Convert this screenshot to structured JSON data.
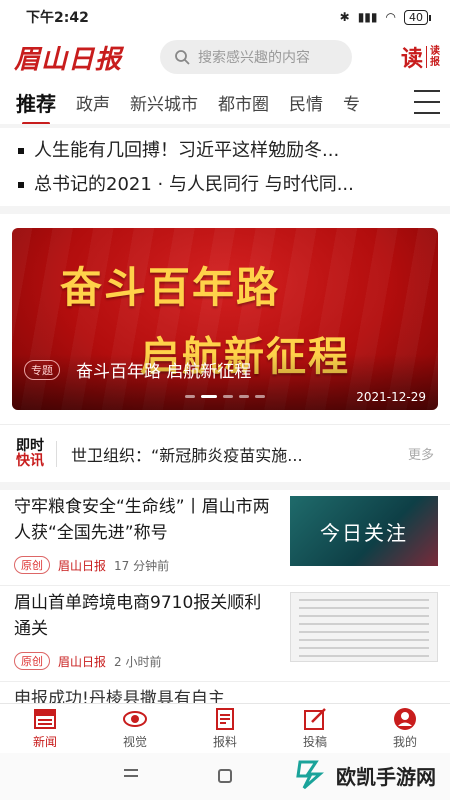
{
  "status": {
    "time": "下午2:42",
    "battery": "40"
  },
  "header": {
    "logo": "眉山日报",
    "search_placeholder": "搜索感兴趣的内容",
    "read_logo_big": "读",
    "read_logo_small": "读报"
  },
  "tabs": [
    "推荐",
    "政声",
    "新兴城市",
    "都市圈",
    "民情",
    "专"
  ],
  "headlines": [
    "人生能有几回搏！习近平这样勉励冬...",
    "总书记的2021 · 与人民同行 与时代同..."
  ],
  "banner": {
    "line1": "奋斗百年路",
    "line2": "启航新征程",
    "tag": "专题",
    "caption": "奋斗百年路 启航新征程",
    "date": "2021-12-29"
  },
  "flash": {
    "badge_top": "即时",
    "badge_bottom": "快讯",
    "text": "世卫组织：“新冠肺炎疫苗实施...",
    "more": "更多"
  },
  "feed": [
    {
      "title": "守牢粮食安全“生命线”丨眉山市两人获“全国先进”称号",
      "orig": "原创",
      "source": "眉山日报",
      "time": "17 分钟前",
      "thumb_text": "今日关注"
    },
    {
      "title": "眉山首单跨境电商9710报关顺利通关",
      "orig": "原创",
      "source": "眉山日报",
      "time": "2 小时前",
      "thumb_text": ""
    },
    {
      "title": "申报成功!丹棱县撒具有自主",
      "orig": "",
      "source": "",
      "time": "",
      "thumb_text": ""
    }
  ],
  "bottom_tabs": [
    "新闻",
    "视觉",
    "报料",
    "投稿",
    "我的"
  ],
  "watermark": "欧凯手游网",
  "colors": {
    "brand": "#c81d1d"
  }
}
